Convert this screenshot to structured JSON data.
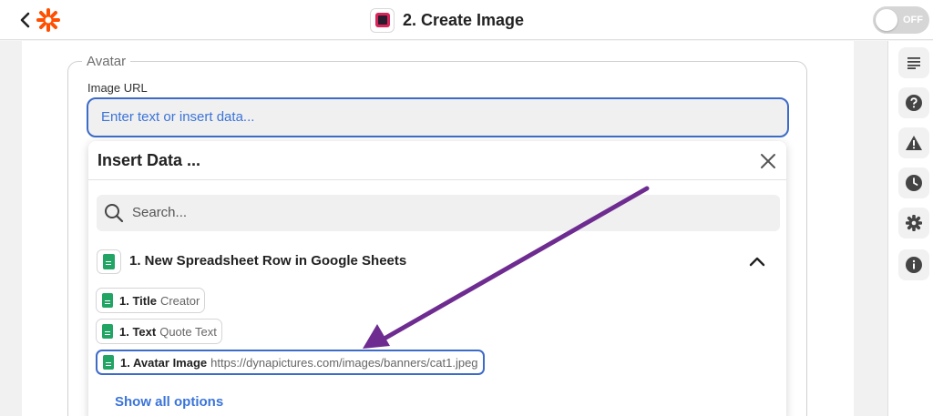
{
  "header": {
    "step_title": "2. Create Image",
    "toggle_label": "OFF"
  },
  "form": {
    "legend": "Avatar",
    "field_label": "Image URL",
    "input_placeholder": "Enter text or insert data..."
  },
  "dropdown": {
    "title": "Insert Data ...",
    "search_placeholder": "Search...",
    "group_title": "1. New Spreadsheet Row in Google Sheets",
    "items": [
      {
        "key": "1. Title",
        "value": "Creator"
      },
      {
        "key": "1. Text",
        "value": "Quote Text"
      },
      {
        "key": "1. Avatar Image",
        "value": "https://dynapictures.com/images/banners/cat1.jpeg"
      }
    ],
    "show_all_label": "Show all options"
  },
  "sidebar": {
    "icons": [
      "notes-icon",
      "help-icon",
      "warning-icon",
      "clock-icon",
      "gear-icon",
      "info-icon"
    ]
  },
  "colors": {
    "accent": "#3d6bc8",
    "brand": "#ff4f00",
    "arrow": "#6e2c91",
    "sheets_green": "#21a464"
  }
}
